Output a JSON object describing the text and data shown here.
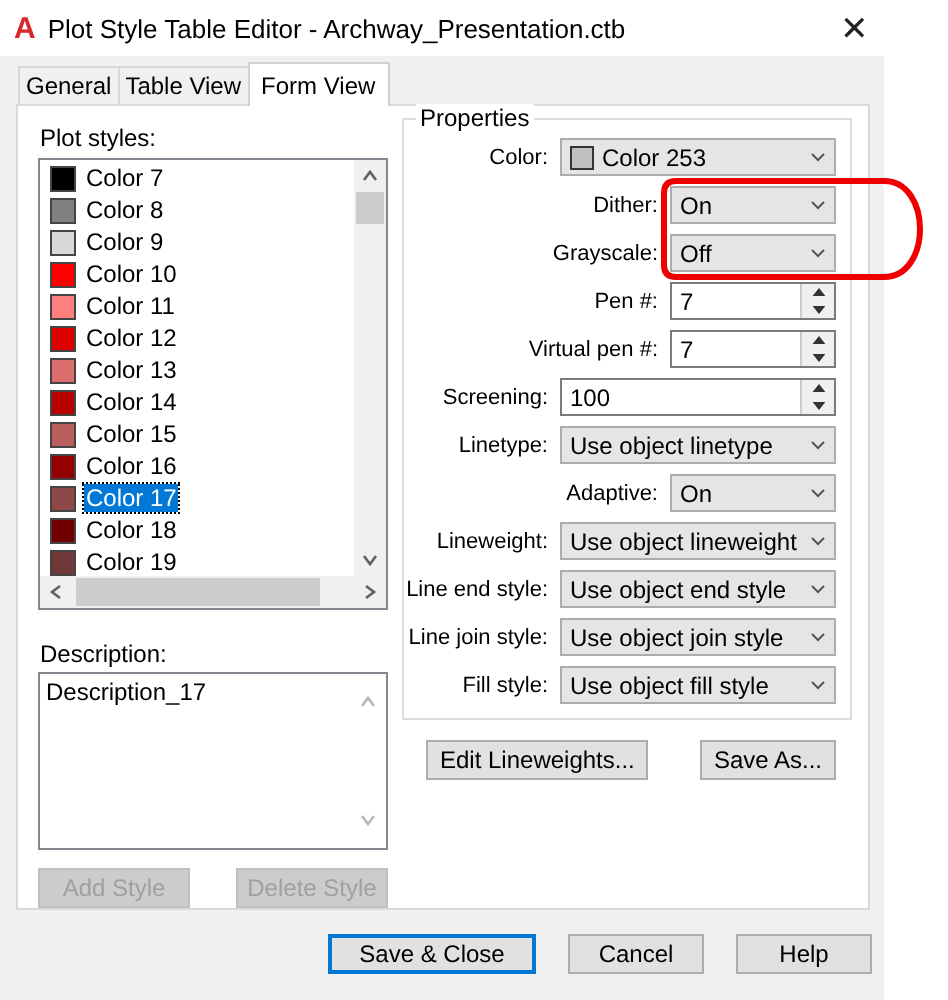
{
  "window": {
    "app_icon": "A",
    "title": "Plot Style Table Editor - Archway_Presentation.ctb",
    "close": "✕"
  },
  "tabs": [
    {
      "label": "General",
      "selected": false
    },
    {
      "label": "Table View",
      "selected": false
    },
    {
      "label": "Form View",
      "selected": true
    }
  ],
  "plot_styles": {
    "label": "Plot styles:",
    "items": [
      {
        "name": "Color 7",
        "color": "#000000",
        "selected": false
      },
      {
        "name": "Color 8",
        "color": "#808080",
        "selected": false
      },
      {
        "name": "Color 9",
        "color": "#d8d8d8",
        "selected": false
      },
      {
        "name": "Color 10",
        "color": "#ff0000",
        "selected": false
      },
      {
        "name": "Color 11",
        "color": "#ff7f7f",
        "selected": false
      },
      {
        "name": "Color 12",
        "color": "#dd0000",
        "selected": false
      },
      {
        "name": "Color 13",
        "color": "#dd6e6e",
        "selected": false
      },
      {
        "name": "Color 14",
        "color": "#b80000",
        "selected": false
      },
      {
        "name": "Color 15",
        "color": "#bd5e5e",
        "selected": false
      },
      {
        "name": "Color 16",
        "color": "#940000",
        "selected": false
      },
      {
        "name": "Color 17",
        "color": "#8f4848",
        "selected": true
      },
      {
        "name": "Color 18",
        "color": "#700000",
        "selected": false
      },
      {
        "name": "Color 19",
        "color": "#703838",
        "selected": false
      }
    ]
  },
  "description": {
    "label": "Description:",
    "value": "Description_17"
  },
  "style_buttons": [
    {
      "label": "Add Style",
      "disabled": true
    },
    {
      "label": "Delete Style",
      "disabled": true
    }
  ],
  "properties": {
    "title": "Properties",
    "rows": [
      {
        "label": "Color:",
        "kind": "color-dropdown",
        "value": "Color 253",
        "color": "#c0c0c0",
        "indented": false
      },
      {
        "label": "Dither:",
        "kind": "dropdown",
        "value": "On",
        "indented": true
      },
      {
        "label": "Grayscale:",
        "kind": "dropdown",
        "value": "Off",
        "indented": true
      },
      {
        "label": "Pen #:",
        "kind": "spin",
        "value": "7",
        "indented": true
      },
      {
        "label": "Virtual pen #:",
        "kind": "spin",
        "value": "7",
        "indented": true
      },
      {
        "label": "Screening:",
        "kind": "spin",
        "value": "100",
        "indented": false
      },
      {
        "label": "Linetype:",
        "kind": "dropdown",
        "value": "Use object linetype",
        "indented": false
      },
      {
        "label": "Adaptive:",
        "kind": "dropdown",
        "value": "On",
        "indented": true
      },
      {
        "label": "Lineweight:",
        "kind": "dropdown",
        "value": "Use object lineweight",
        "indented": false
      },
      {
        "label": "Line end style:",
        "kind": "dropdown",
        "value": "Use object end style",
        "indented": false
      },
      {
        "label": "Line join style:",
        "kind": "dropdown",
        "value": "Use object join style",
        "indented": false
      },
      {
        "label": "Fill style:",
        "kind": "dropdown",
        "value": "Use object fill style",
        "indented": false
      }
    ]
  },
  "property_buttons": [
    "Edit Lineweights...",
    "Save As..."
  ],
  "dialog_buttons": [
    {
      "label": "Save & Close",
      "default": true
    },
    {
      "label": "Cancel",
      "default": false
    },
    {
      "label": "Help",
      "default": false
    }
  ]
}
